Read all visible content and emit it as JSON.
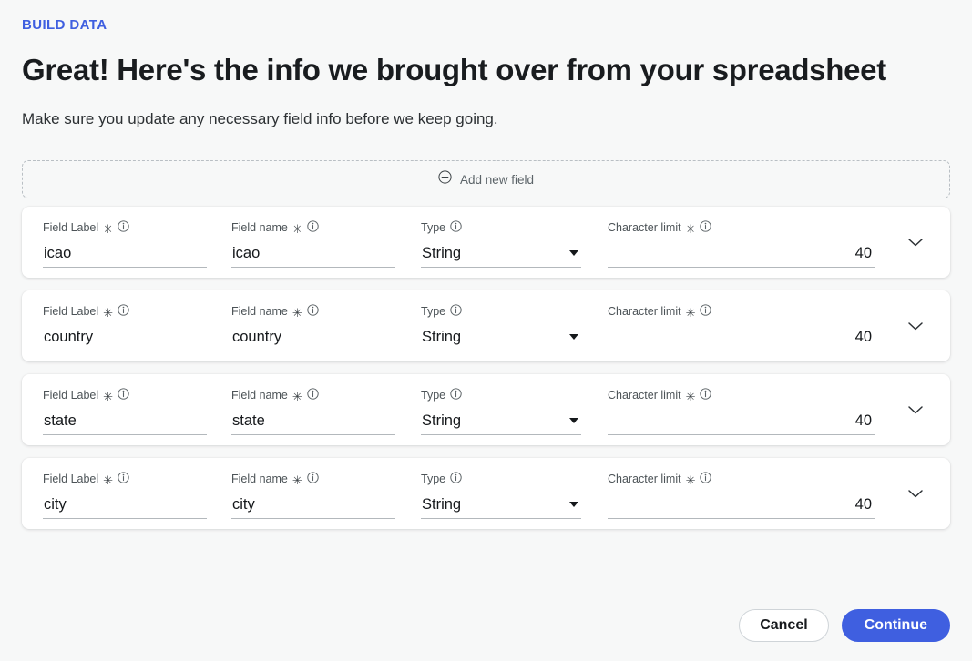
{
  "header": {
    "eyebrow": "BUILD DATA",
    "title": "Great! Here's the info we brought over from your spreadsheet",
    "subtitle": "Make sure you update any necessary field info before we keep going."
  },
  "add_field": {
    "label": "Add new field",
    "icon": "plus-circle-icon"
  },
  "columns": {
    "field_label": "Field Label",
    "field_name": "Field name",
    "type": "Type",
    "character_limit": "Character limit",
    "required_marker": "✳",
    "info_icon": "info-icon"
  },
  "fields": [
    {
      "label": "icao",
      "name": "icao",
      "type": "String",
      "character_limit": "40"
    },
    {
      "label": "country",
      "name": "country",
      "type": "String",
      "character_limit": "40"
    },
    {
      "label": "state",
      "name": "state",
      "type": "String",
      "character_limit": "40"
    },
    {
      "label": "city",
      "name": "city",
      "type": "String",
      "character_limit": "40"
    }
  ],
  "footer": {
    "cancel_label": "Cancel",
    "continue_label": "Continue"
  },
  "colors": {
    "accent": "#3f5fe0",
    "page_background": "#f7f8f8",
    "card_background": "#ffffff",
    "underline": "#b3b8bc",
    "muted_text": "#4c5357"
  }
}
